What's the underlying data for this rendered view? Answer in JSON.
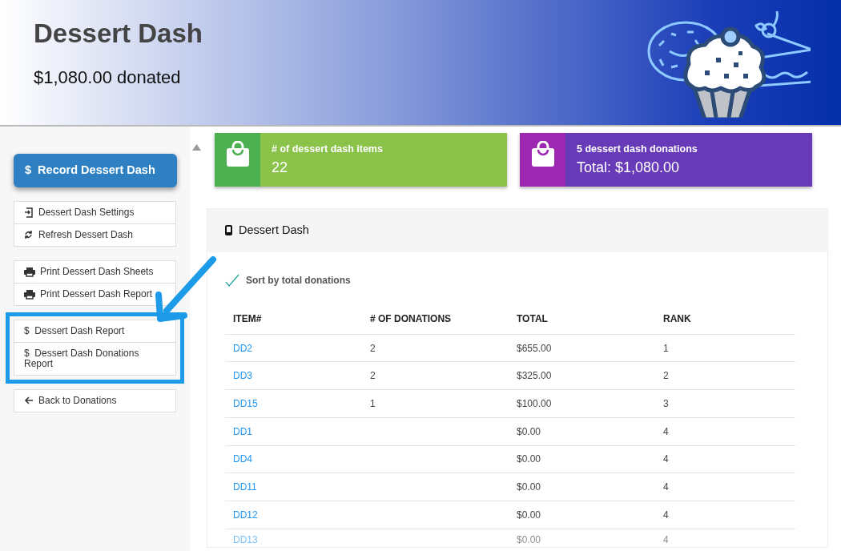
{
  "header": {
    "title": "Dessert Dash",
    "subtitle": "$1,080.00 donated"
  },
  "sidebar": {
    "primary_button": {
      "symbol": "$",
      "label": "Record Dessert Dash"
    },
    "groups": [
      {
        "highlighted": false,
        "items": [
          {
            "kind": "settings",
            "label": "Dessert Dash Settings"
          },
          {
            "kind": "refresh",
            "label": "Refresh Dessert Dash"
          }
        ]
      },
      {
        "highlighted": false,
        "items": [
          {
            "kind": "print",
            "label": "Print Dessert Dash Sheets"
          },
          {
            "kind": "print",
            "label": "Print Dessert Dash Report"
          }
        ]
      },
      {
        "highlighted": true,
        "items": [
          {
            "kind": "symbol",
            "symbol": "$",
            "label": "Dessert Dash Report"
          },
          {
            "kind": "symbol",
            "symbol": "$",
            "label": "Dessert Dash Donations Report"
          }
        ]
      },
      {
        "highlighted": false,
        "items": [
          {
            "kind": "back",
            "label": "Back to Donations"
          }
        ]
      }
    ]
  },
  "stats": [
    {
      "label": "# of dessert dash items",
      "value": "22",
      "color": "#8bc34a"
    },
    {
      "label": "5 dessert dash donations",
      "value": "Total: $1,080.00",
      "color": "#673ab7"
    }
  ],
  "panel": {
    "title": "Dessert Dash",
    "sort_option": {
      "label": "Sort by total donations",
      "checked": true
    },
    "table": {
      "columns": [
        "ITEM#",
        "# OF DONATIONS",
        "TOTAL",
        "RANK"
      ],
      "rows": [
        [
          "DD2",
          "2",
          "$655.00",
          "1"
        ],
        [
          "DD3",
          "2",
          "$325.00",
          "2"
        ],
        [
          "DD15",
          "1",
          "$100.00",
          "3"
        ],
        [
          "DD1",
          "",
          "$0.00",
          "4"
        ],
        [
          "DD4",
          "",
          "$0.00",
          "4"
        ],
        [
          "DD11",
          "",
          "$0.00",
          "4"
        ],
        [
          "DD12",
          "",
          "$0.00",
          "4"
        ],
        [
          "DD13",
          "",
          "$0.00",
          "4"
        ]
      ]
    }
  }
}
